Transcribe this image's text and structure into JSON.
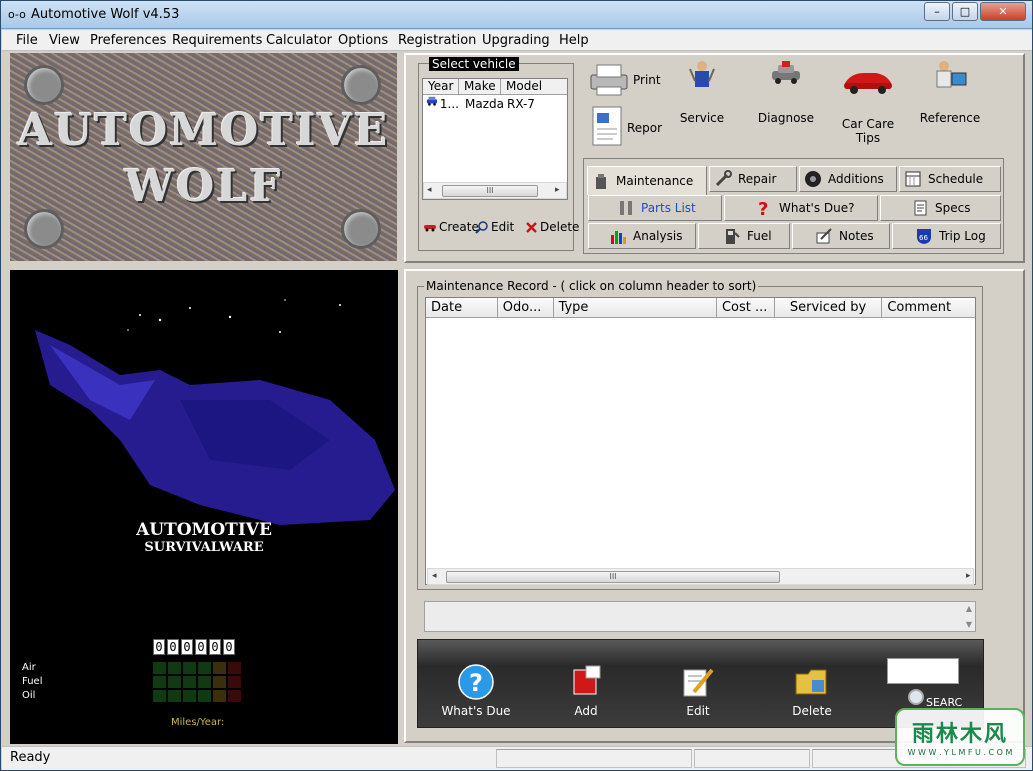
{
  "window": {
    "title": "Automotive Wolf v4.53",
    "min": "–",
    "max": "□",
    "close": "✕"
  },
  "menu": [
    "File",
    "View",
    "Preferences",
    "Requirements",
    "Calculator",
    "Options",
    "Registration",
    "Upgrading",
    "Help"
  ],
  "logo": {
    "line1": "AUTOMOTIVE",
    "line2": "WOLF"
  },
  "splash": {
    "title": "AUTOMOTIVE",
    "subtitle": "SURVIVALWARE",
    "odometer": [
      "0",
      "0",
      "0",
      "0",
      "0",
      "0"
    ],
    "gauges": [
      "Air",
      "Fuel",
      "Oil"
    ],
    "miles_label": "Miles/Year:"
  },
  "vehicle": {
    "legend": "Select vehicle",
    "columns": [
      "Year",
      "Make",
      "Model"
    ],
    "rows": [
      {
        "year": "1...",
        "make": "Mazda",
        "model": "RX-7"
      }
    ],
    "scroll_grip": "III",
    "create": "Create",
    "edit": "Edit",
    "delete": "Delete"
  },
  "tools": {
    "print": "Print",
    "report": "Repor",
    "service": "Service",
    "diagnose": "Diagnose",
    "car_care": "Car Care Tips",
    "reference": "Reference"
  },
  "tabs": {
    "maintenance": "Maintenance",
    "repair": "Repair",
    "additions": "Additions",
    "schedule": "Schedule",
    "parts_list": "Parts List",
    "whats_due": "What's Due?",
    "specs": "Specs",
    "analysis": "Analysis",
    "fuel": "Fuel",
    "notes": "Notes",
    "trip_log": "Trip Log"
  },
  "record": {
    "legend": "Maintenance Record - ( click on column header to sort)",
    "columns": [
      "Date",
      "Odo...",
      "Type",
      "Cost ...",
      "Serviced by",
      "Comment"
    ],
    "scroll_grip": "III"
  },
  "actions": {
    "whats_due": "What's Due",
    "add": "Add",
    "edit": "Edit",
    "delete": "Delete",
    "search": "SEARC"
  },
  "status": {
    "text": "Ready"
  },
  "watermark": {
    "line1": "雨林木风",
    "line2": "W W W . Y L M F U . C O M"
  },
  "colors": {
    "accent": "#1a5fb4",
    "wolf": "#2a1fa0",
    "splash_bg": "#000000"
  }
}
